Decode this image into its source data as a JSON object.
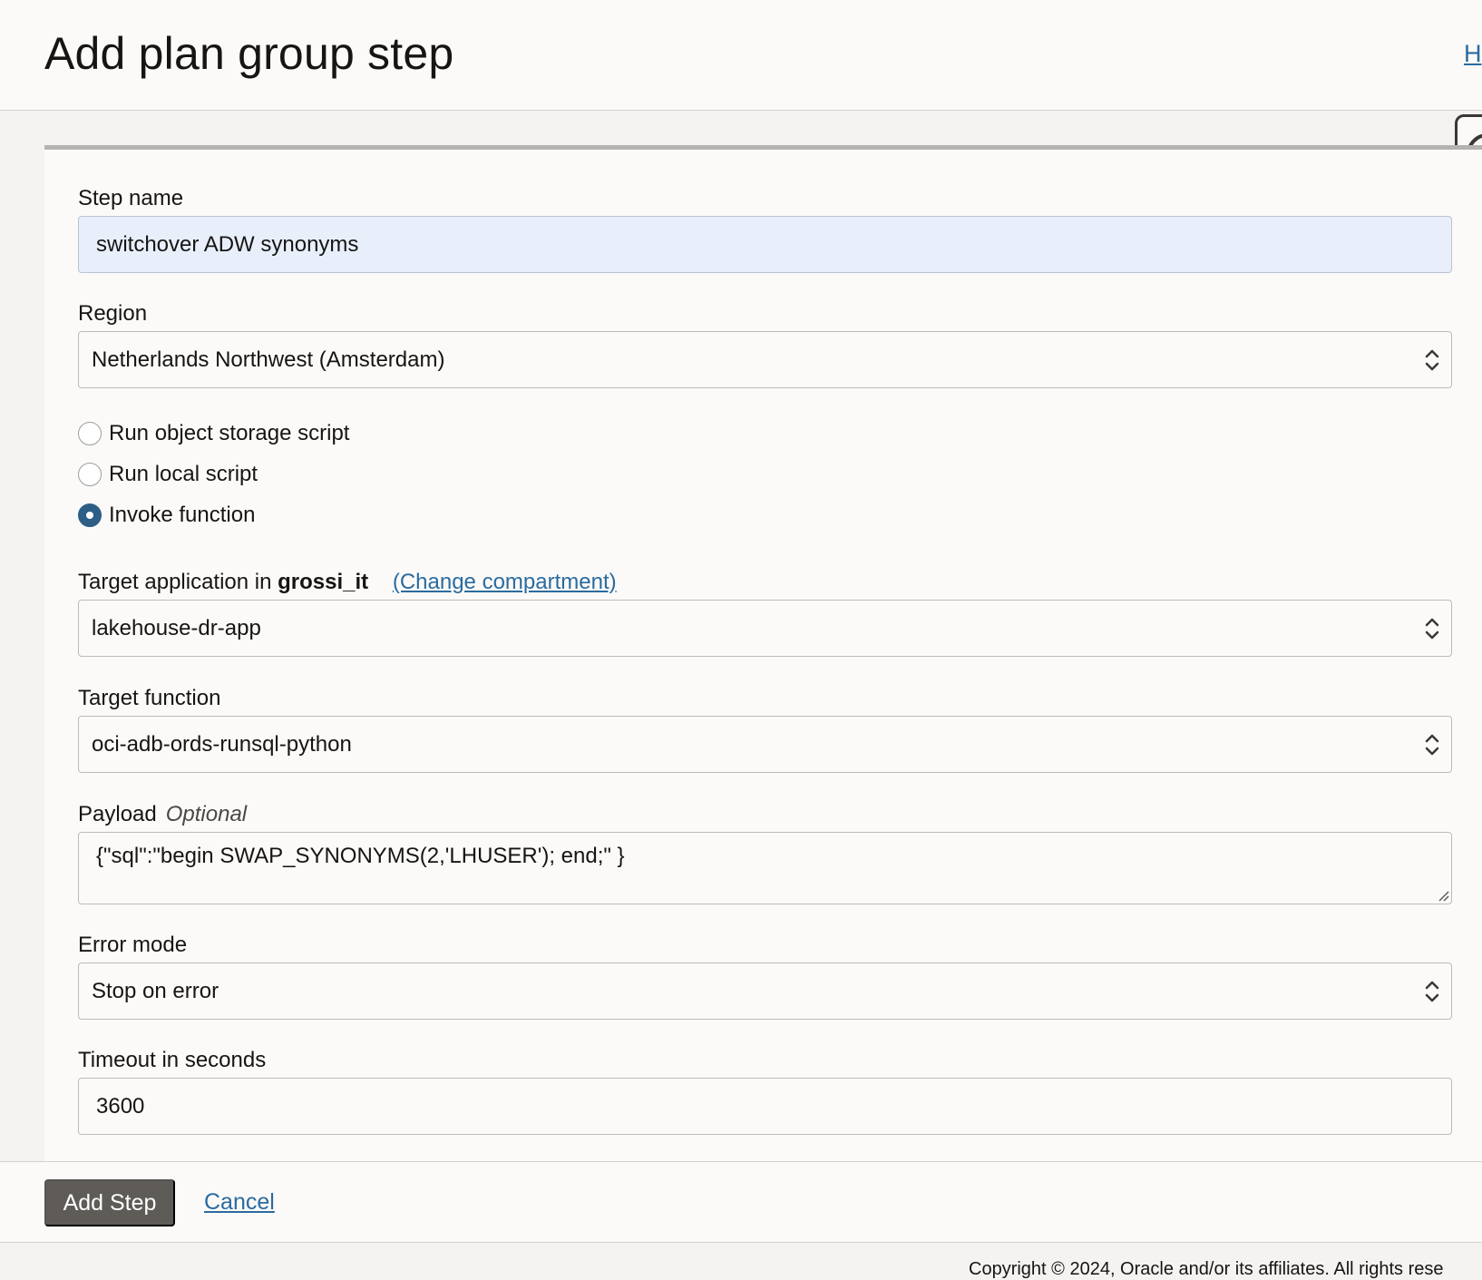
{
  "header": {
    "title": "Add plan group step",
    "help_link": "H"
  },
  "form": {
    "step_name": {
      "label": "Step name",
      "value": "switchover ADW synonyms"
    },
    "region": {
      "label": "Region",
      "value": "Netherlands Northwest (Amsterdam)"
    },
    "step_type": {
      "options": [
        {
          "label": "Run object storage script",
          "checked": false
        },
        {
          "label": "Run local script",
          "checked": false
        },
        {
          "label": "Invoke function",
          "checked": true
        }
      ]
    },
    "target_application": {
      "label_prefix": "Target application in",
      "compartment": "grossi_it",
      "change_link": "(Change compartment)",
      "value": "lakehouse-dr-app"
    },
    "target_function": {
      "label": "Target function",
      "value": "oci-adb-ords-runsql-python"
    },
    "payload": {
      "label": "Payload",
      "optional": "Optional",
      "value": "{\"sql\":\"begin SWAP_SYNONYMS(2,'LHUSER'); end;\" }"
    },
    "error_mode": {
      "label": "Error mode",
      "value": "Stop on error"
    },
    "timeout": {
      "label": "Timeout in seconds",
      "value": "3600"
    }
  },
  "footer": {
    "add_step_label": "Add Step",
    "cancel_label": "Cancel",
    "copyright": "Copyright © 2024, Oracle and/or its affiliates. All rights rese"
  }
}
